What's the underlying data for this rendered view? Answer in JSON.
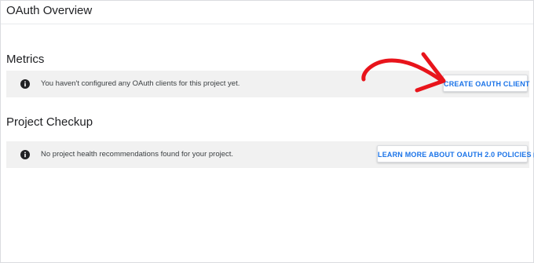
{
  "header": {
    "title": "OAuth Overview"
  },
  "metrics": {
    "heading": "Metrics",
    "message": "You haven't configured any OAuth clients for this project yet.",
    "button_label": "CREATE OAUTH CLIENT",
    "icon": "info-icon"
  },
  "project_checkup": {
    "heading": "Project Checkup",
    "message": "No project health recommendations found for your project.",
    "button_label": "LEARN MORE ABOUT OAUTH 2.0 POLICIES",
    "button_icon": "external-link-icon",
    "icon": "info-icon"
  },
  "annotation": {
    "arrow_color": "#e8141b",
    "icon": "red-arrow-icon"
  },
  "colors": {
    "accent": "#1a73e8",
    "banner_background": "#f1f1f1",
    "text": "#202124"
  }
}
